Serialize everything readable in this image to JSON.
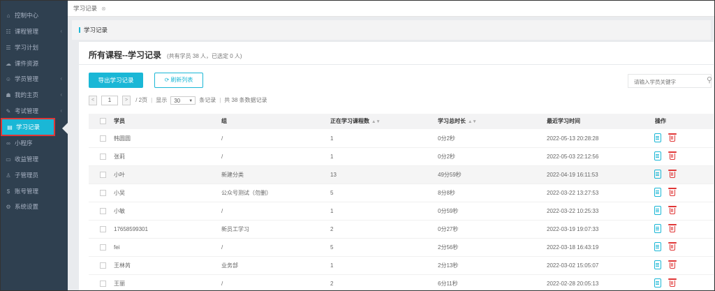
{
  "sidebar": {
    "items": [
      {
        "label": "控制中心",
        "icon": "home-icon",
        "glyph": "⌂",
        "chevron": false
      },
      {
        "label": "课程管理",
        "icon": "book-icon",
        "glyph": "☷",
        "chevron": true
      },
      {
        "label": "学习计划",
        "icon": "plan-icon",
        "glyph": "☰",
        "chevron": false
      },
      {
        "label": "课件资源",
        "icon": "cloud-icon",
        "glyph": "☁",
        "chevron": false
      },
      {
        "label": "学员管理",
        "icon": "users-icon",
        "glyph": "☺",
        "chevron": true
      },
      {
        "label": "我的主页",
        "icon": "homepage-icon",
        "glyph": "☗",
        "chevron": true
      },
      {
        "label": "考试管理",
        "icon": "exam-icon",
        "glyph": "✎",
        "chevron": true
      },
      {
        "label": "学习记录",
        "icon": "record-icon",
        "glyph": "▤",
        "chevron": false,
        "active": true
      },
      {
        "label": "小程序",
        "icon": "miniapp-icon",
        "glyph": "∞",
        "chevron": false
      },
      {
        "label": "收益管理",
        "icon": "income-icon",
        "glyph": "▭",
        "chevron": false
      },
      {
        "label": "子管理员",
        "icon": "subadmin-icon",
        "glyph": "♙",
        "chevron": false
      },
      {
        "label": "账号管理",
        "icon": "account-icon",
        "glyph": "$",
        "chevron": false
      },
      {
        "label": "系统设置",
        "icon": "gear-icon",
        "glyph": "⚙",
        "chevron": false
      }
    ]
  },
  "topbar": {
    "tab_label": "学习记录",
    "tab_close": "⊗"
  },
  "breadcrumb": "学习记录",
  "panel": {
    "title": "所有课程--学习记录",
    "subtitle": "(共有学员 38 人，已选定 0 人)",
    "export_label": "导出学习记录",
    "refresh_label": "刷新列表",
    "search_placeholder": "请输入学员关键字"
  },
  "pager": {
    "prev": "<",
    "current_page": "1",
    "next": ">",
    "total_pages": "/ 2页",
    "show_label": "显示",
    "page_size": "30",
    "per_page_suffix": "条记录",
    "total_records": "共 38 条数据记录"
  },
  "table": {
    "headers": {
      "student": "学员",
      "group": "组",
      "courses": "正在学习课程数",
      "duration": "学习总时长",
      "last_time": "最近学习时间",
      "action": "操作"
    },
    "rows": [
      {
        "student": "韩圆圆",
        "group": "/",
        "courses": "1",
        "duration": "0分2秒",
        "last_time": "2022-05-13 20:28:28"
      },
      {
        "student": "张莉",
        "group": "/",
        "courses": "1",
        "duration": "0分2秒",
        "last_time": "2022-05-03 22:12:56"
      },
      {
        "student": "小叶",
        "group": "新建分类",
        "courses": "13",
        "duration": "49分59秒",
        "last_time": "2022-04-19 16:11:53",
        "highlight": true
      },
      {
        "student": "小吴",
        "group": "公众号测试（勿删）",
        "courses": "5",
        "duration": "8分8秒",
        "last_time": "2022-03-22 13:27:53"
      },
      {
        "student": "小敏",
        "group": "/",
        "courses": "1",
        "duration": "0分59秒",
        "last_time": "2022-03-22 10:25:33"
      },
      {
        "student": "17658599301",
        "group": "新员工学习",
        "courses": "2",
        "duration": "0分27秒",
        "last_time": "2022-03-19 19:07:33"
      },
      {
        "student": "fei",
        "group": "/",
        "courses": "5",
        "duration": "2分56秒",
        "last_time": "2022-03-18 16:43:19"
      },
      {
        "student": "王林芮",
        "group": "业务部",
        "courses": "1",
        "duration": "2分13秒",
        "last_time": "2022-03-02 15:05:07"
      },
      {
        "student": "王丽",
        "group": "/",
        "courses": "2",
        "duration": "6分11秒",
        "last_time": "2022-02-28 20:05:13"
      }
    ]
  },
  "colors": {
    "sidebar_bg": "#2f4050",
    "accent": "#1ab7d6",
    "danger": "#e03636"
  }
}
